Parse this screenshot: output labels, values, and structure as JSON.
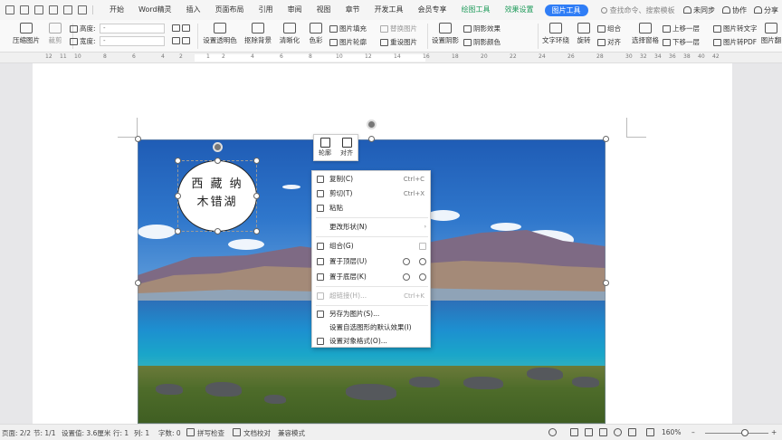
{
  "menubar": {
    "items": [
      "开始",
      "Word精灵",
      "插入",
      "页面布局",
      "引用",
      "审阅",
      "视图",
      "章节",
      "开发工具",
      "会员专享"
    ],
    "context_tabs": [
      "绘图工具",
      "效果设置"
    ],
    "active_tab": "图片工具",
    "search_placeholder": "查找命令、搜索模板",
    "sync": "未同步",
    "collab": "协作",
    "share": "分享"
  },
  "ribbon": {
    "compress": "压缩图片",
    "crop": "裁剪",
    "height_label": "高度:",
    "width_label": "宽度:",
    "height_value": "-",
    "width_value": "-",
    "set_transparent": "设置透明色",
    "cutout_bg": "抠除背景",
    "sharpen": "清晰化",
    "color": "色彩",
    "pic_fill": "图片填充",
    "pic_outline": "图片轮廓",
    "replace_pic": "替换图片",
    "reset_pic": "重设图片",
    "set_shadow": "设置阴影",
    "shadow_effect": "阴影效果",
    "shadow_color": "阴影颜色",
    "text_wrap": "文字环绕",
    "rotate": "旋转",
    "group": "组合",
    "align": "对齐",
    "selection_pane": "选择窗格",
    "bring_forward": "上移一层",
    "send_backward": "下移一层",
    "pic_to_text": "图片转文字",
    "pic_to_pdf": "图片转PDF",
    "pic_translate": "图片翻"
  },
  "ruler": [
    "12",
    "11",
    "10",
    "8",
    "6",
    "4",
    "2",
    "1",
    "2",
    "4",
    "6",
    "8",
    "10",
    "12",
    "14",
    "16",
    "18",
    "20",
    "22",
    "24",
    "26",
    "28",
    "30",
    "32",
    "34",
    "36",
    "38",
    "40",
    "42"
  ],
  "ellipse_text": {
    "line1": "西 藏 纳",
    "line2": "木错湖"
  },
  "mini_toolbar": {
    "outline": "轮廓",
    "align": "对齐"
  },
  "context_menu": [
    {
      "label": "复制(C)",
      "shortcut": "Ctrl+C",
      "disabled": false
    },
    {
      "label": "剪切(T)",
      "shortcut": "Ctrl+X",
      "disabled": false
    },
    {
      "label": "粘贴",
      "shortcut": "",
      "disabled": false
    },
    {
      "label": "更改形状(N)",
      "shortcut": "",
      "disabled": false
    },
    {
      "label": "组合(G)",
      "shortcut": "",
      "disabled": false
    },
    {
      "label": "置于顶层(U)",
      "shortcut": "",
      "disabled": false
    },
    {
      "label": "置于底层(K)",
      "shortcut": "",
      "disabled": false
    },
    {
      "label": "超链接(H)...",
      "shortcut": "Ctrl+K",
      "disabled": true
    },
    {
      "label": "另存为图片(S)...",
      "shortcut": "",
      "disabled": false
    },
    {
      "label": "设置自选图形的默认效果(I)",
      "shortcut": "",
      "disabled": false
    },
    {
      "label": "设置对象格式(O)...",
      "shortcut": "",
      "disabled": false
    }
  ],
  "status": {
    "page": "页面: 2/2",
    "section": "节: 1/1",
    "setting": "设置值: 3.6厘米",
    "row": "行: 1",
    "col": "列: 1",
    "words": "字数: 0",
    "spell": "拼写检查",
    "doc_check": "文档校对",
    "compat": "兼容模式",
    "zoom": "160%"
  },
  "colors": {
    "accent": "#2f7df6",
    "green_tab": "#1e9b5a"
  }
}
